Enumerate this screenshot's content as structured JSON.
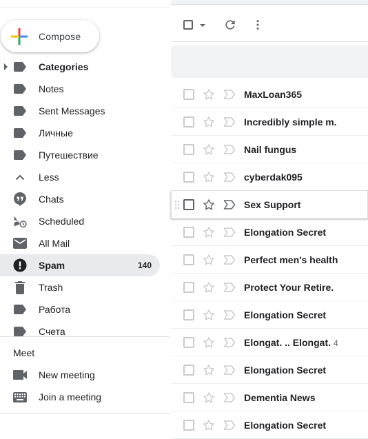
{
  "compose": {
    "label": "Compose"
  },
  "sidebar": {
    "items": [
      {
        "label": "Categories",
        "icon": "label-icon",
        "bold": true,
        "expander": true
      },
      {
        "label": "Notes",
        "icon": "label-icon"
      },
      {
        "label": "Sent Messages",
        "icon": "label-icon"
      },
      {
        "label": "Личные",
        "icon": "label-icon"
      },
      {
        "label": "Путешествие",
        "icon": "label-icon"
      },
      {
        "label": "Less",
        "icon": "chevron-up-icon"
      },
      {
        "label": "Chats",
        "icon": "chat-icon"
      },
      {
        "label": "Scheduled",
        "icon": "scheduled-send-icon"
      },
      {
        "label": "All Mail",
        "icon": "mail-icon"
      },
      {
        "label": "Spam",
        "icon": "report-spam-icon",
        "active": true,
        "count": "140"
      },
      {
        "label": "Trash",
        "icon": "trash-icon"
      },
      {
        "label": "Работа",
        "icon": "label-icon"
      },
      {
        "label": "Счета",
        "icon": "label-icon"
      }
    ],
    "meet": {
      "title": "Meet",
      "items": [
        {
          "label": "New meeting",
          "icon": "videocam-icon"
        },
        {
          "label": "Join a meeting",
          "icon": "keyboard-icon"
        }
      ]
    }
  },
  "toolbar": {
    "select_icon": "checkbox-icon",
    "refresh_icon": "refresh-icon",
    "more_icon": "more-vert-icon"
  },
  "emails": [
    {
      "sender": "MaxLoan365"
    },
    {
      "sender": "Incredibly simple m."
    },
    {
      "sender": "Nail fungus"
    },
    {
      "sender": "cyberdak095"
    },
    {
      "sender": "Sex Support",
      "hovered": true
    },
    {
      "sender": "Elongation Secret"
    },
    {
      "sender": "Perfect men's health"
    },
    {
      "sender": "Protect Your Retire."
    },
    {
      "sender": "Elongation Secret"
    },
    {
      "sender": "Elongat. .. Elongat.",
      "thread_count": "4"
    },
    {
      "sender": "Elongation Secret"
    },
    {
      "sender": "Dementia News"
    },
    {
      "sender": "Elongation Secret"
    }
  ],
  "colors": {
    "active_bg": "#e8eaed",
    "icon": "#5f6368",
    "text": "#202124"
  }
}
